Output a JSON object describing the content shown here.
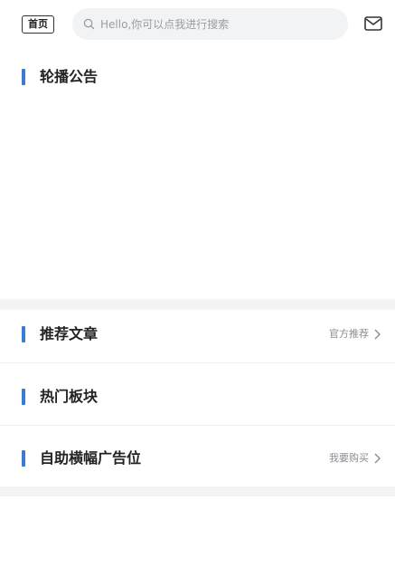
{
  "header": {
    "home_label": "首页",
    "search_placeholder": "Hello,你可以点我进行搜索"
  },
  "sections": {
    "carousel": {
      "title": "轮播公告"
    },
    "recommended": {
      "title": "推荐文章",
      "action": "官方推荐"
    },
    "hot": {
      "title": "热门板块"
    },
    "ad": {
      "title": "自助横幅广告位",
      "action": "我要购买"
    }
  },
  "colors": {
    "accent_bar": "#3a7bd5",
    "divider": "#f2f3f5"
  },
  "icons": [
    "search-icon",
    "mail-icon",
    "chevron-right-icon"
  ]
}
